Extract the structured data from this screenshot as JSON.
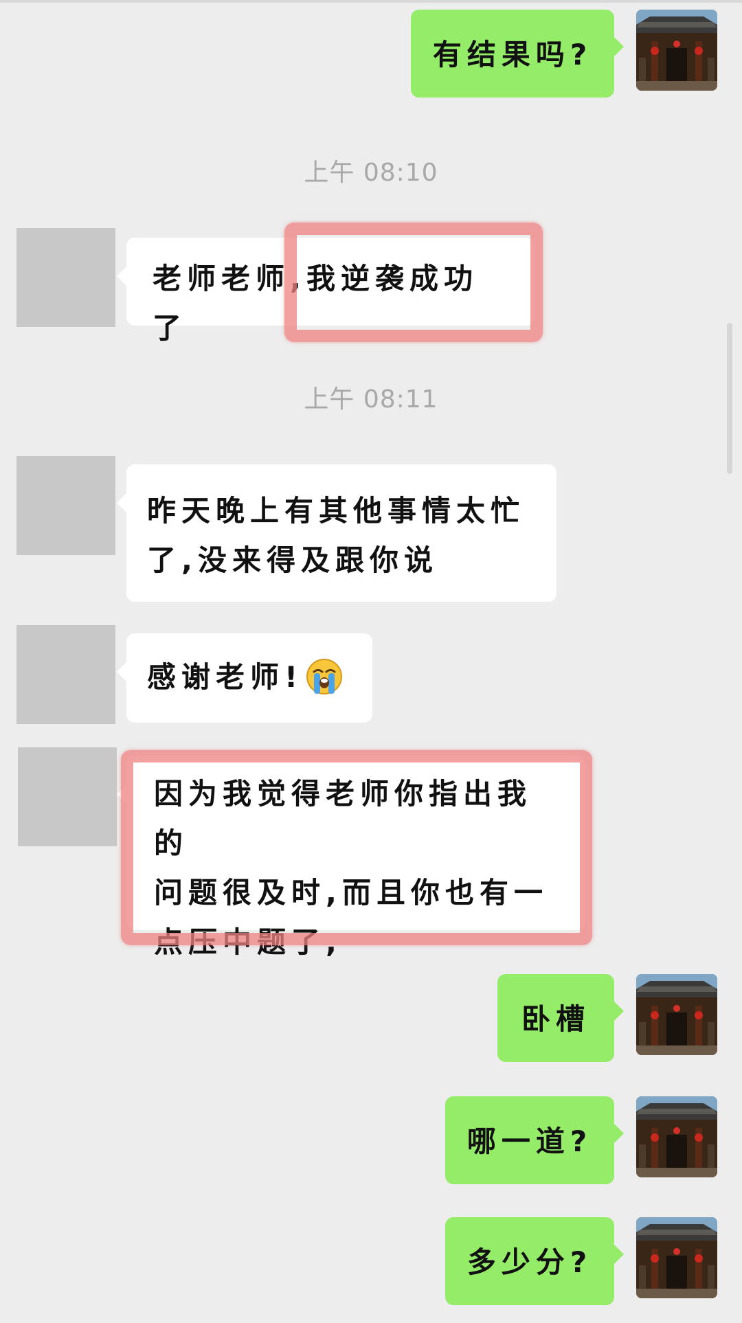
{
  "messages": {
    "m1": "有结果吗?",
    "t1": "上午 08:10",
    "m2": "老师老师,我逆袭成功了",
    "t2": "上午 08:11",
    "m3_line1": "昨天晚上有其他事情太忙",
    "m3_line2": "了,没来得及跟你说",
    "m4": "感谢老师!",
    "m5_line1": "因为我觉得老师你指出我的",
    "m5_line2": "问题很及时,而且你也有一",
    "m5_line3": "点压中题了,",
    "m6": "卧槽",
    "m7": "哪一道?",
    "m8": "多少分?"
  },
  "icons": {
    "emoji": "crying-face-emoji",
    "self_avatar": "temple-gate-photo"
  },
  "colors": {
    "background": "#ededed",
    "outgoing_bubble": "#95ec69",
    "incoming_bubble": "#ffffff",
    "highlight": "#ee8080",
    "timestamp": "#a8a8a8"
  }
}
